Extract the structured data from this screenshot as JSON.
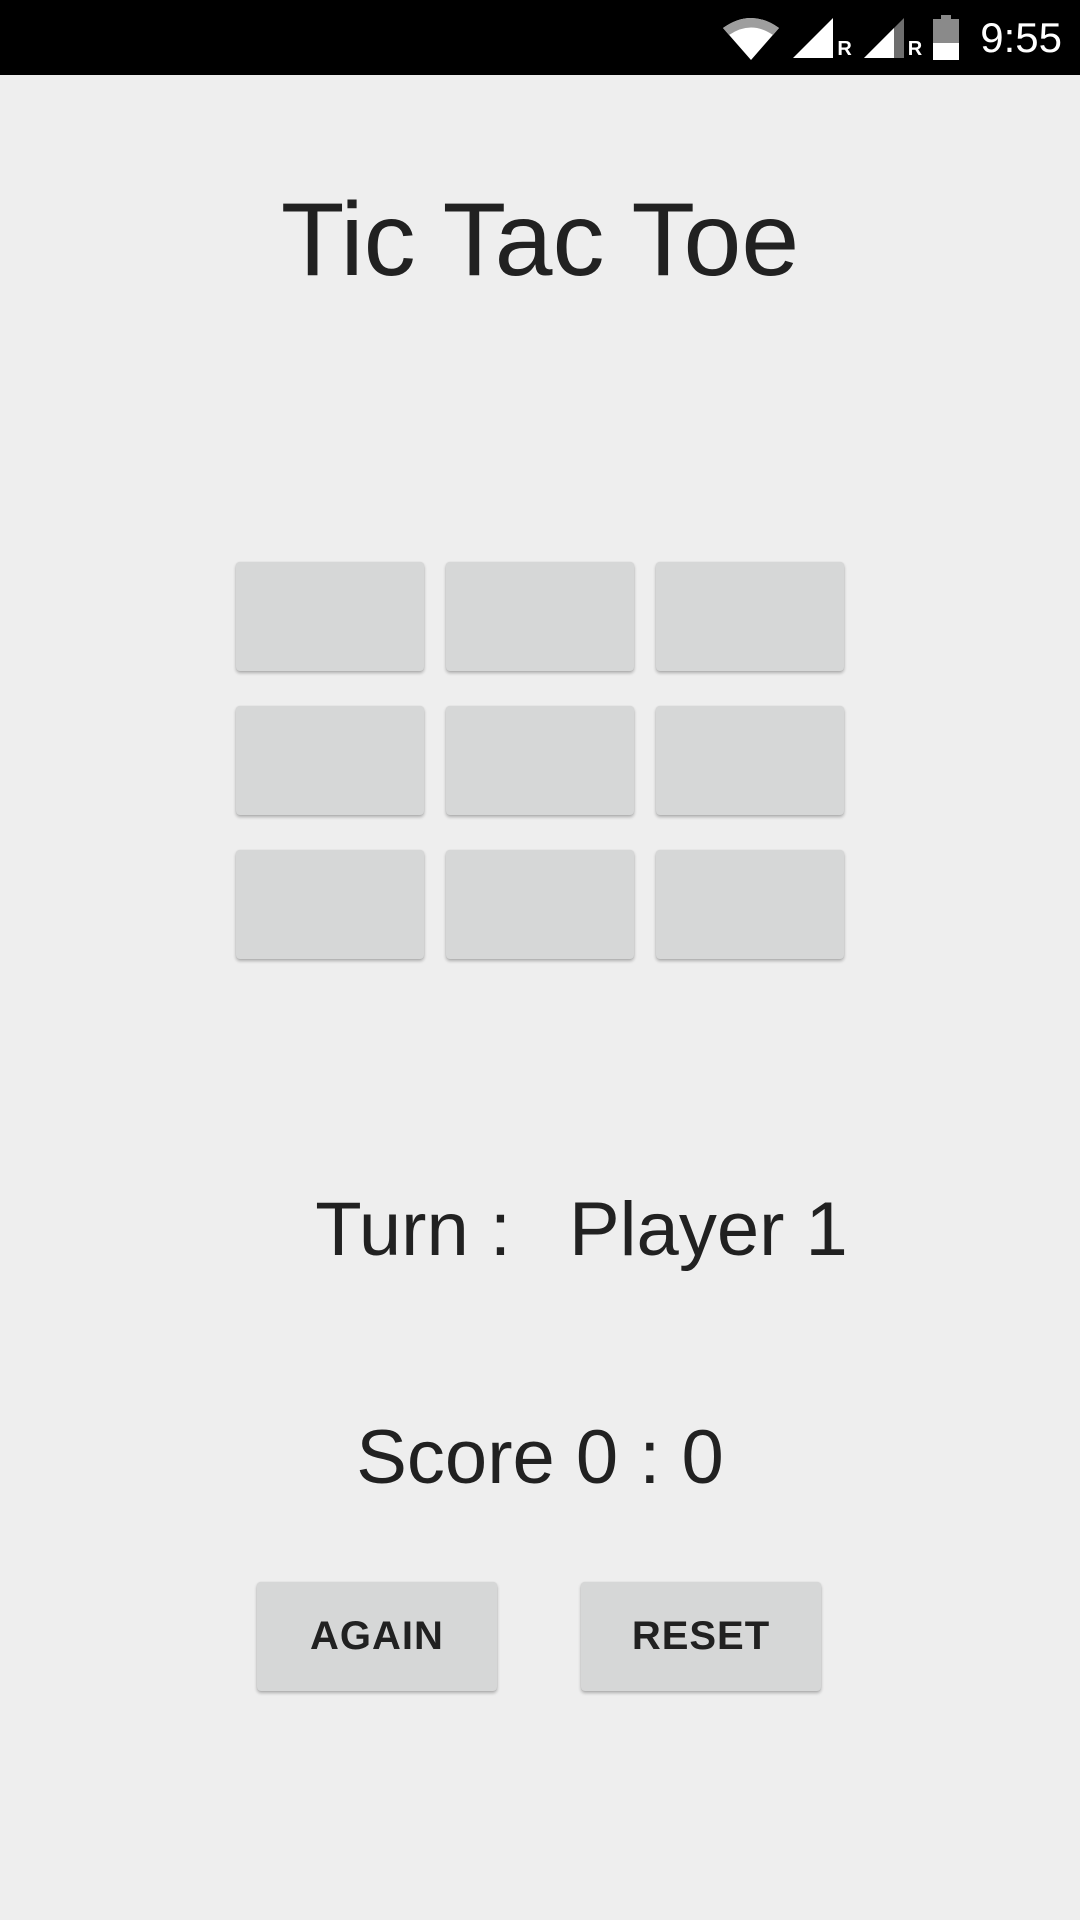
{
  "status_bar": {
    "time": "9:55",
    "icons": [
      "wifi-icon",
      "signal-icon",
      "roaming-indicator",
      "signal-icon",
      "roaming-indicator",
      "battery-icon"
    ],
    "roaming_label": "R"
  },
  "title": "Tic Tac Toe",
  "board": {
    "cells": [
      "",
      "",
      "",
      "",
      "",
      "",
      "",
      "",
      ""
    ]
  },
  "turn": {
    "label": "Turn :",
    "player": "Player 1"
  },
  "score": {
    "text": "Score 0 : 0"
  },
  "buttons": {
    "again_label": "AGAIN",
    "reset_label": "RESET"
  },
  "colors": {
    "background": "#eeeeee",
    "status_bar": "#000000",
    "button": "#d6d7d7",
    "text": "#212121"
  }
}
